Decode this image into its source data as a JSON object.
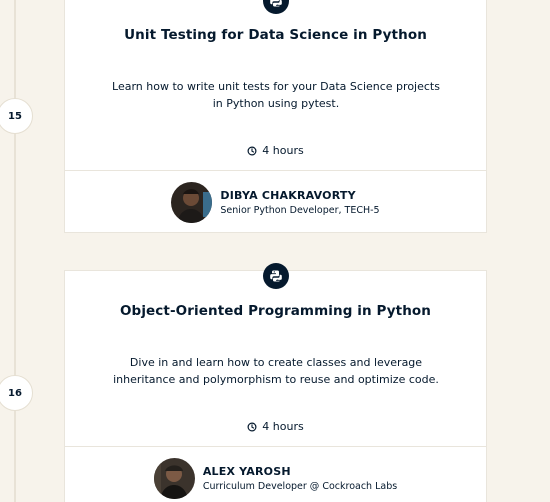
{
  "courses": [
    {
      "step": "15",
      "icon": "python-icon",
      "title": "Unit Testing for Data Science in Python",
      "description": "Learn how to write unit tests for your Data Science projects in Python using pytest.",
      "duration": "4 hours",
      "author_name": "DIBYA CHAKRAVORTY",
      "author_role": "Senior Python Developer, TECH-5"
    },
    {
      "step": "16",
      "icon": "python-icon",
      "title": "Object-Oriented Programming in Python",
      "description": "Dive in and learn how to create classes and leverage inheritance and polymorphism to reuse and optimize code.",
      "duration": "4 hours",
      "author_name": "ALEX YAROSH",
      "author_role": "Curriculum Developer @ Cockroach Labs"
    }
  ],
  "colors": {
    "background": "#f7f3eb",
    "navy": "#05192d",
    "card": "#ffffff",
    "border": "#e9e5dc"
  }
}
